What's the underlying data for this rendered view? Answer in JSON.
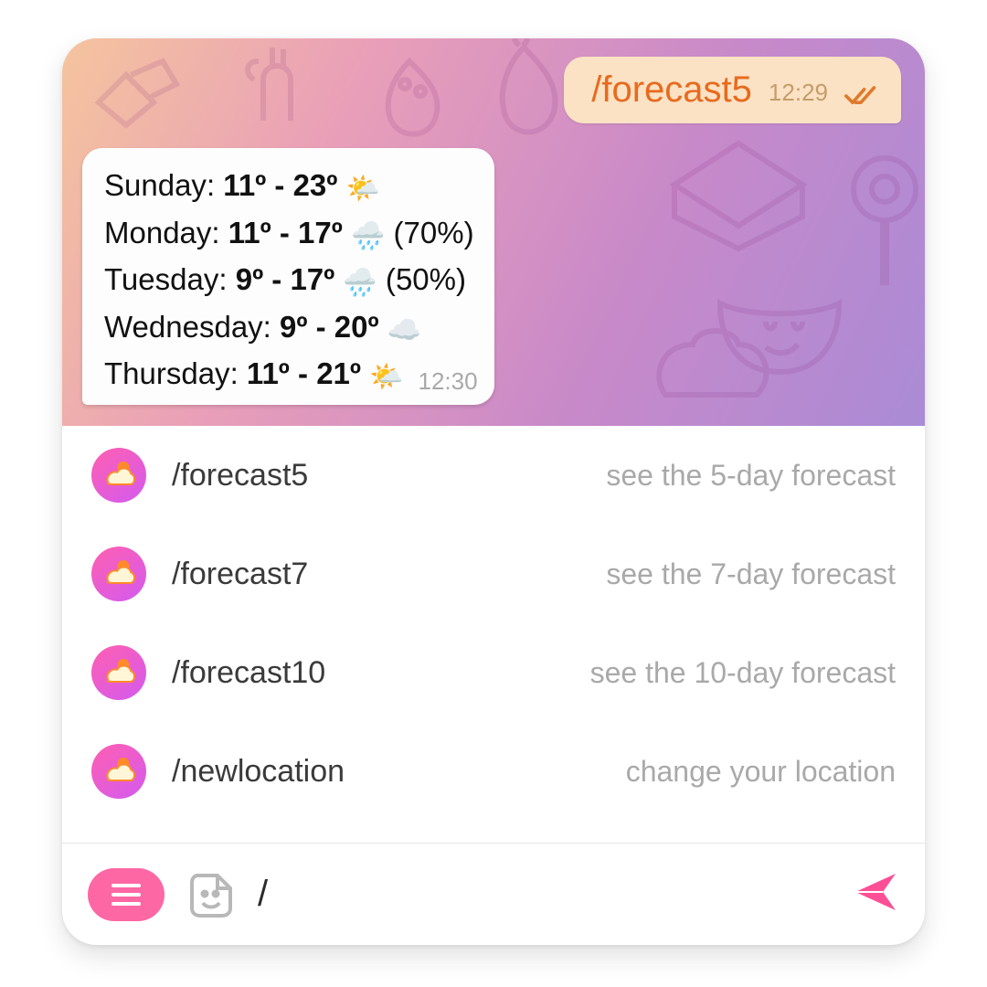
{
  "messages": {
    "out": {
      "text": "/forecast5",
      "time": "12:29"
    },
    "in": {
      "time": "12:30",
      "rows": [
        {
          "day": "Sunday",
          "low": 11,
          "high": 23,
          "icon": "🌤️"
        },
        {
          "day": "Monday",
          "low": 11,
          "high": 17,
          "icon": "🌧️",
          "chance": "70%"
        },
        {
          "day": "Tuesday",
          "low": 9,
          "high": 17,
          "icon": "🌧️",
          "chance": "50%"
        },
        {
          "day": "Wednesday",
          "low": 9,
          "high": 20,
          "icon": "☁️"
        },
        {
          "day": "Thursday",
          "low": 11,
          "high": 21,
          "icon": "🌤️"
        }
      ]
    }
  },
  "commands": [
    {
      "cmd": "/forecast5",
      "desc": "see the 5-day forecast"
    },
    {
      "cmd": "/forecast7",
      "desc": "see the 7-day forecast"
    },
    {
      "cmd": "/forecast10",
      "desc": "see the 10-day forecast"
    },
    {
      "cmd": "/newlocation",
      "desc": "change your location"
    }
  ],
  "input": {
    "value": "/"
  },
  "colors": {
    "accent": "#fd4f96",
    "outgoing_text": "#e86a1e",
    "secondary": "#a9a9a9"
  }
}
